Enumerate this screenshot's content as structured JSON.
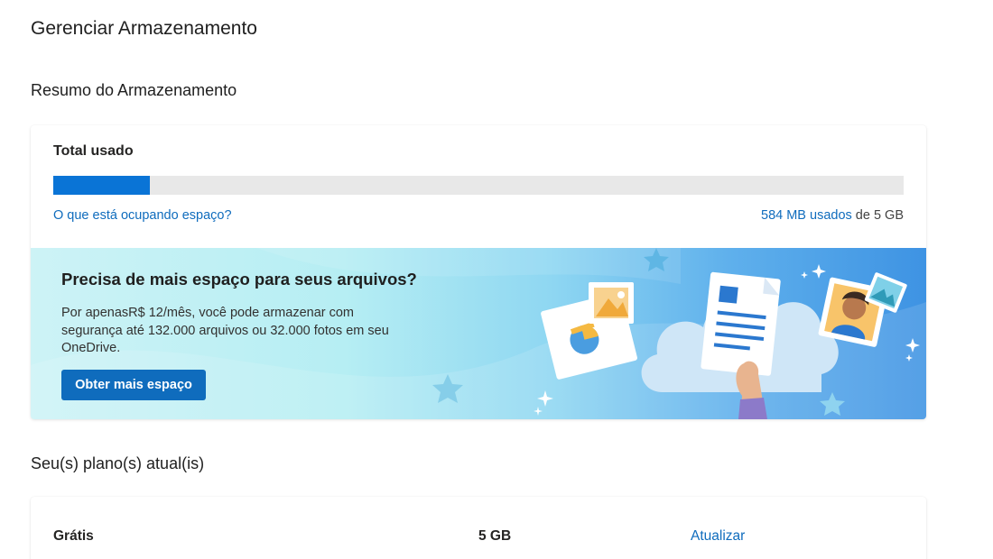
{
  "page": {
    "title": "Gerenciar Armazenamento"
  },
  "summary": {
    "section_title": "Resumo do Armazenamento",
    "total_label": "Total usado",
    "usage_fraction": 0.114,
    "whats_taking_link": "O que está ocupando espaço?",
    "used_amount": "584 MB usados",
    "used_suffix": " de 5 GB"
  },
  "promo": {
    "title": "Precisa de mais espaço para seus arquivos?",
    "body": "Por apenasR$ 12/mês, você pode armazenar com segurança até 132.000 arquivos ou 32.000 fotos em seu OneDrive.",
    "button_label": "Obter mais espaço"
  },
  "plans": {
    "section_title": "Seu(s) plano(s) atual(is)",
    "items": [
      {
        "name": "Grátis",
        "size": "5 GB",
        "action": "Atualizar"
      }
    ]
  },
  "colors": {
    "accent": "#0f6cbd",
    "progress_fill": "#0a74d6",
    "progress_track": "#e8e8e8"
  }
}
